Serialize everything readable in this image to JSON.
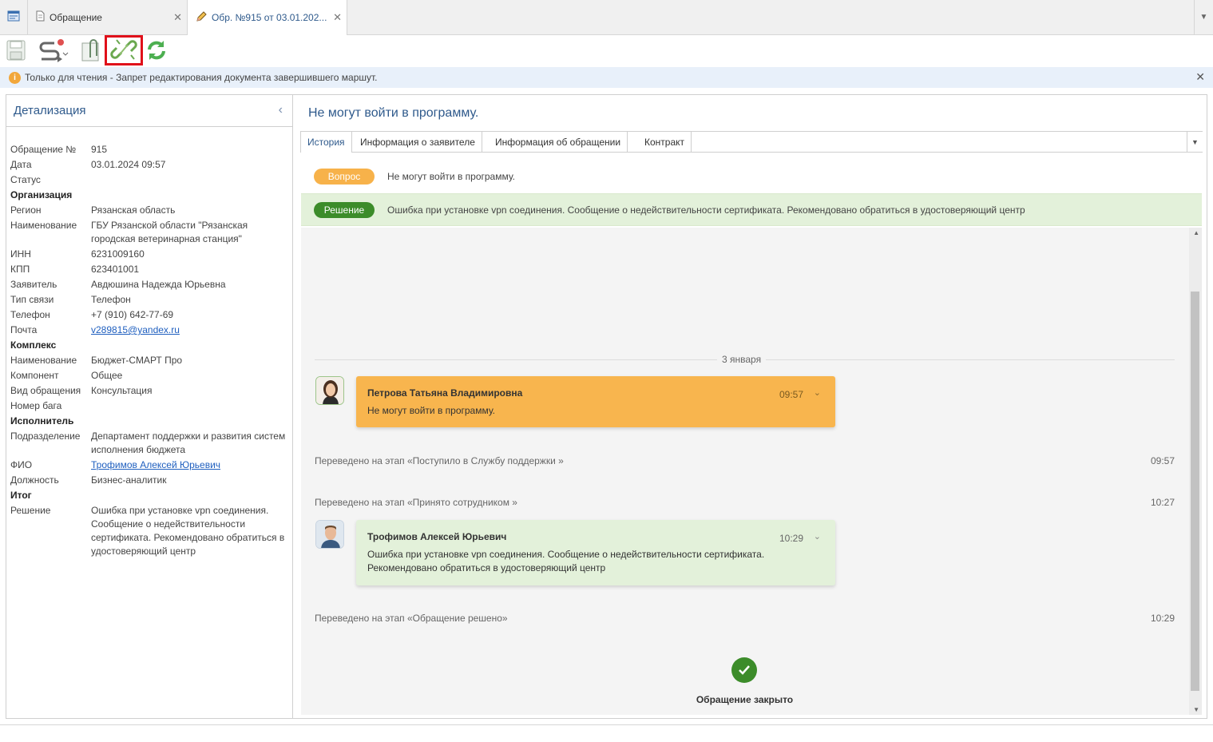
{
  "tabs": {
    "tab1_label": "Обращение",
    "tab2_label": "Обр. №915 от 03.01.202..."
  },
  "infobar": {
    "text": "Только для чтения - Запрет редактирования документа завершившего маршут."
  },
  "left": {
    "title": "Детализация",
    "rows": {
      "num_k": "Обращение №",
      "num_v": "915",
      "date_k": "Дата",
      "date_v": "03.01.2024 09:57",
      "status_k": "Статус",
      "org_section": "Организация",
      "region_k": "Регион",
      "region_v": "Рязанская область",
      "name_k": "Наименование",
      "name_v": "ГБУ Рязанской области \"Рязанская городская ветеринарная станция\"",
      "inn_k": "ИНН",
      "inn_v": "6231009160",
      "kpp_k": "КПП",
      "kpp_v": "623401001",
      "applicant_k": "Заявитель",
      "applicant_v": "Авдюшина Надежда Юрьевна",
      "contact_k": "Тип связи",
      "contact_v": "Телефон",
      "phone_k": "Телефон",
      "phone_v": "+7 (910) 642-77-69",
      "mail_k": "Почта",
      "mail_v": "v289815@yandex.ru",
      "complex_section": "Комплекс",
      "cname_k": "Наименование",
      "cname_v": "Бюджет-СМАРТ Про",
      "comp_k": "Компонент",
      "comp_v": "Общее",
      "kind_k": "Вид обращения",
      "kind_v": "Консультация",
      "bug_k": "Номер бага",
      "exec_section": "Исполнитель",
      "dept_k": "Подразделение",
      "dept_v": "Департамент поддержки и развития систем исполнения бюджета",
      "fio_k": "ФИО",
      "fio_v": "Трофимов Алексей Юрьевич",
      "pos_k": "Должность",
      "pos_v": "Бизнес-аналитик",
      "result_section": "Итог",
      "sol_k": "Решение",
      "sol_v": "Ошибка при установке vpn соединения. Сообщение о недействительности сертификата. Рекомендовано обратиться в удостоверяющий центр"
    }
  },
  "right": {
    "title": "Не могут войти в программу.",
    "tabs": [
      "История",
      "Информация о заявителе",
      "Информация об обращении",
      "Контракт"
    ],
    "question_pill": "Вопрос",
    "question_text": "Не могут войти в программу.",
    "solution_pill": "Решение",
    "solution_text": "Ошибка при установке vpn соединения. Сообщение о недействительности сертификата. Рекомендовано обратиться в удостоверяющий центр",
    "day_label": "3 января",
    "msg1": {
      "name": "Петрова Татьяна Владимировна",
      "time": "09:57",
      "text": "Не могут войти в программу."
    },
    "stage1": {
      "text": "Переведено на этап «Поступило в Службу поддержки »",
      "time": "09:57"
    },
    "stage2": {
      "text": "Переведено на этап «Принято сотрудником »",
      "time": "10:27"
    },
    "msg2": {
      "name": "Трофимов Алексей Юрьевич",
      "time": "10:29",
      "text": "Ошибка при установке vpn соединения. Сообщение о недействительности сертификата. Рекомендовано обратиться в удостоверяющий центр"
    },
    "stage3": {
      "text": "Переведено на этап «Обращение решено»",
      "time": "10:29"
    },
    "closed_text": "Обращение закрыто"
  }
}
